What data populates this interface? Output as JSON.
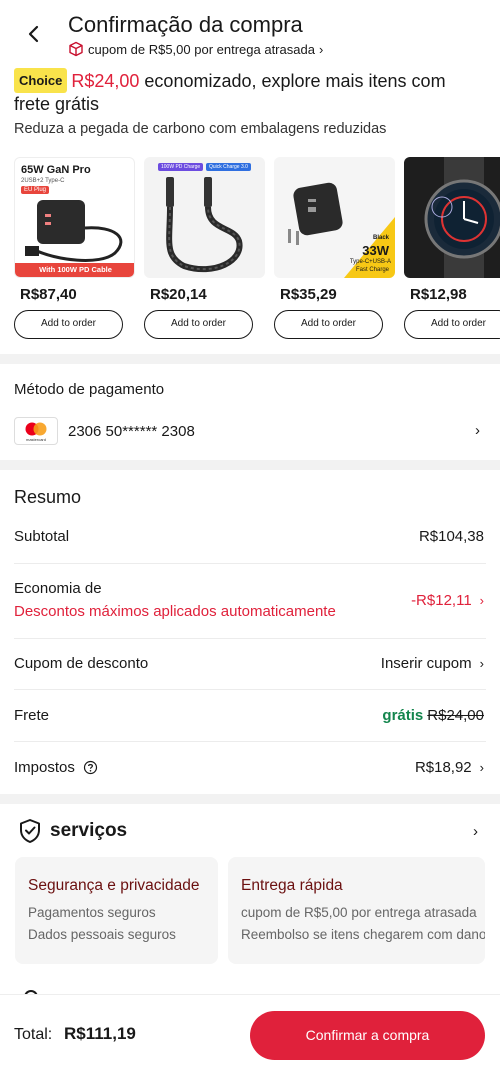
{
  "header": {
    "title": "Confirmação da compra",
    "coupon_text": "cupom de R$5,00 por entrega atrasada"
  },
  "promo": {
    "badge": "Choice",
    "amount": "R$24,00",
    "text": "economizado, explore mais itens com frete grátis",
    "carbon": "Reduza a pegada de carbono com embalagens reduzidas"
  },
  "products": [
    {
      "price": "R$87,40",
      "button": "Add to order",
      "image_label": "65W GaN Pro",
      "image_sub": "2USB+2 Type-C",
      "image_tag": "EU Plug",
      "image_footer": "With 100W PD Cable"
    },
    {
      "price": "R$20,14",
      "button": "Add to order",
      "image_label": "100W PD Charge",
      "image_label2": "Quick Charge 3.0"
    },
    {
      "price": "R$35,29",
      "button": "Add to order",
      "image_label": "Black",
      "image_big": "33W",
      "image_sub": "Type-C+USB-A",
      "image_footer": "Fast Charge"
    },
    {
      "price": "R$12,98",
      "button": "Add to order"
    }
  ],
  "payment": {
    "title": "Método de pagamento",
    "card_number": "2306 50****** 2308",
    "card_brand": "mastercard"
  },
  "summary": {
    "title": "Resumo",
    "subtotal_label": "Subtotal",
    "subtotal_value": "R$104,38",
    "savings_label": "Economia de",
    "savings_sub": "Descontos máximos aplicados automaticamente",
    "savings_value": "-R$12,11",
    "coupon_label": "Cupom de desconto",
    "coupon_value": "Inserir cupom",
    "shipping_label": "Frete",
    "shipping_free": "grátis",
    "shipping_old": "R$24,00",
    "taxes_label": "Impostos",
    "taxes_value": "R$18,92"
  },
  "services": {
    "title": "serviços",
    "cards": [
      {
        "title": "Segurança e privacidade",
        "items": [
          "Pagamentos seguros",
          "Dados pessoais seguros"
        ]
      },
      {
        "title": "Entrega rápida",
        "items": [
          "cupom de R$5,00 por entrega atrasada",
          "Reembolso se itens chegarem com dano"
        ]
      }
    ]
  },
  "footer": {
    "total_label": "Total:",
    "total_value": "R$111,19",
    "confirm_label": "Confirmar a compra"
  },
  "colors": {
    "accent": "#e0213b",
    "choice_badge": "#f9e34b",
    "free_green": "#13854d",
    "service_title": "#6b1010"
  }
}
